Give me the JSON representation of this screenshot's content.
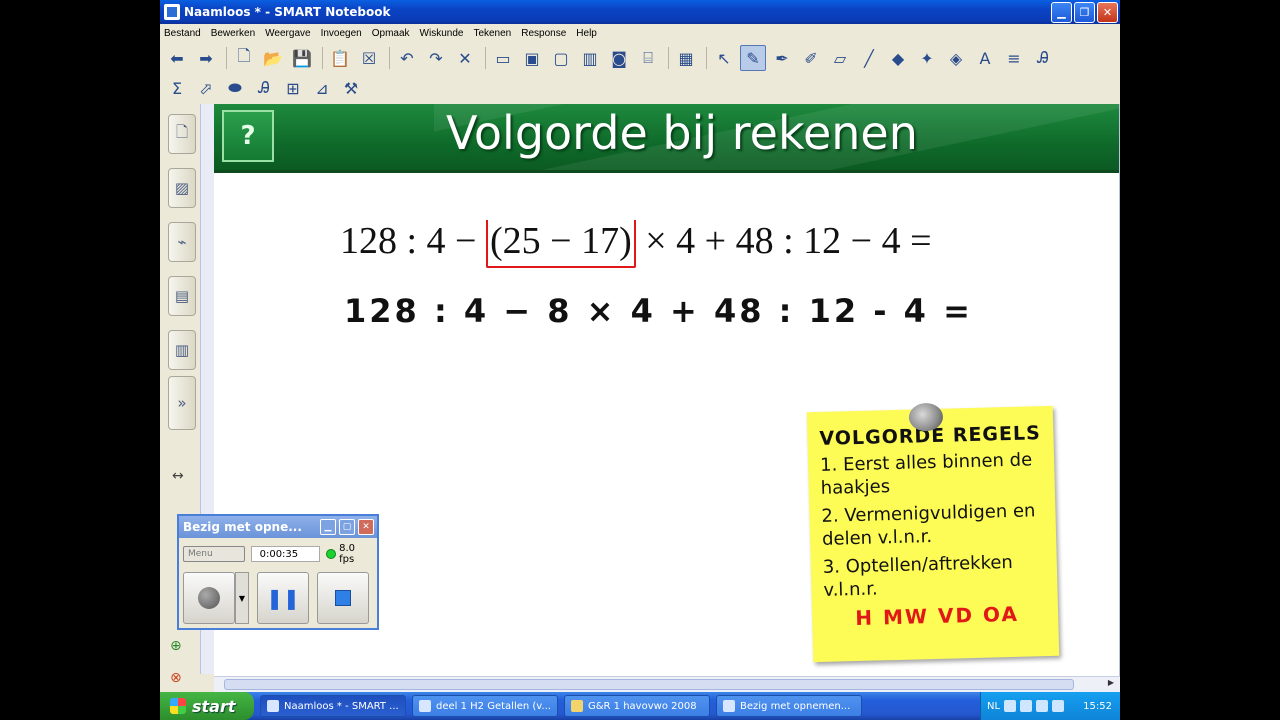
{
  "window": {
    "title": "Naamloos * - SMART Notebook",
    "minimize": "▁",
    "maximize": "❐",
    "close": "✕"
  },
  "menu": [
    "Bestand",
    "Bewerken",
    "Weergave",
    "Invoegen",
    "Opmaak",
    "Wiskunde",
    "Tekenen",
    "Response",
    "Help"
  ],
  "toolbar1": [
    {
      "name": "back-icon",
      "glyph": "⬅"
    },
    {
      "name": "forward-icon",
      "glyph": "➡"
    },
    {
      "name": "new-page-icon",
      "glyph": "🗋"
    },
    {
      "name": "open-icon",
      "glyph": "📂"
    },
    {
      "name": "save-icon",
      "glyph": "💾"
    },
    {
      "name": "paste-icon",
      "glyph": "📋"
    },
    {
      "name": "delete-page-icon",
      "glyph": "☒"
    },
    {
      "name": "undo-icon",
      "glyph": "↶"
    },
    {
      "name": "redo-icon",
      "glyph": "↷"
    },
    {
      "name": "delete-icon",
      "glyph": "✕"
    },
    {
      "name": "screen-shade-icon",
      "glyph": "▭"
    },
    {
      "name": "full-screen-icon",
      "glyph": "▣"
    },
    {
      "name": "transparent-bg-icon",
      "glyph": "▢"
    },
    {
      "name": "dual-page-icon",
      "glyph": "▥"
    },
    {
      "name": "camera-icon",
      "glyph": "◙"
    },
    {
      "name": "document-camera-icon",
      "glyph": "⌸"
    },
    {
      "name": "table-icon",
      "glyph": "▦"
    },
    {
      "name": "select-icon",
      "glyph": "↖"
    },
    {
      "name": "pen-icon",
      "glyph": "✎",
      "active": true
    },
    {
      "name": "creative-pen-icon",
      "glyph": "✒"
    },
    {
      "name": "highlighter-icon",
      "glyph": "✐"
    },
    {
      "name": "eraser-icon",
      "glyph": "▱"
    },
    {
      "name": "line-icon",
      "glyph": "╱"
    },
    {
      "name": "shapes-icon",
      "glyph": "◆"
    },
    {
      "name": "magic-pen-icon",
      "glyph": "✦"
    },
    {
      "name": "fill-icon",
      "glyph": "◈"
    },
    {
      "name": "text-icon",
      "glyph": "A"
    },
    {
      "name": "properties-icon",
      "glyph": "≡"
    },
    {
      "name": "handwriting-icon",
      "glyph": "Ꭿ"
    }
  ],
  "toolbar2": [
    {
      "name": "sigma-icon",
      "glyph": "Σ"
    },
    {
      "name": "shape-recognition-icon",
      "glyph": "⬀"
    },
    {
      "name": "magic-eraser-icon",
      "glyph": "⬬"
    },
    {
      "name": "recognition-icon",
      "glyph": "Ꭿ"
    },
    {
      "name": "text-format-icon",
      "glyph": "⊞"
    },
    {
      "name": "chart-icon",
      "glyph": "⊿"
    },
    {
      "name": "toolbox-icon",
      "glyph": "⚒"
    }
  ],
  "slide": {
    "question_mark": "?",
    "title": "Volgorde bij rekenen",
    "eq1_before": "128 : 4 − ",
    "eq1_bracket": "(25 − 17)",
    "eq1_after": " × 4 + 48 : 12 − 4 =",
    "eq2": "128 : 4  −  8 × 4 + 48 : 12 - 4 ="
  },
  "note": {
    "title": "VOLGORDE REGELS",
    "items": [
      "1. Eerst alles binnen de haakjes",
      "2. Vermenigvuldigen en delen v.l.n.r.",
      "3. Optellen/aftrekken v.l.n.r."
    ],
    "footer": "H MW VD OA"
  },
  "recorder": {
    "title": "Bezig met opne...",
    "menu": "Menu",
    "time": "0:00:35",
    "fps": "8.0 fps"
  },
  "taskbar": {
    "start": "start",
    "tasks": [
      {
        "label": "Naamloos * - SMART ...",
        "active": true
      },
      {
        "label": "deel 1 H2 Getallen (v..."
      },
      {
        "label": "G&R  1 havovwo 2008"
      },
      {
        "label": "Bezig met opnemen..."
      }
    ],
    "lang": "NL",
    "clock": "15:52"
  }
}
